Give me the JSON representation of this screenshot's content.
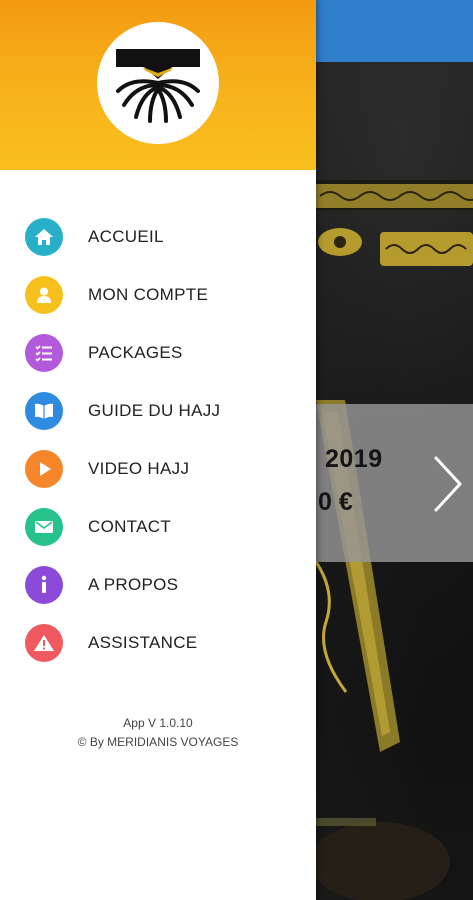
{
  "colors": {
    "header_top": "#f39a12",
    "header_bottom": "#f9bf1e",
    "topbar": "#2f7ecb",
    "icon_home": "#29b0c9",
    "icon_account": "#f7c11d",
    "icon_packages": "#b25adb",
    "icon_guide": "#2f8be0",
    "icon_video": "#f7852a",
    "icon_contact": "#27c28c",
    "icon_about": "#8c4ad8",
    "icon_assistance": "#ef5a61"
  },
  "drawer": {
    "logo": "meridianis-logo",
    "menu": [
      {
        "label": "ACCUEIL",
        "icon": "home-icon"
      },
      {
        "label": "MON COMPTE",
        "icon": "user-icon"
      },
      {
        "label": "PACKAGES",
        "icon": "checklist-icon"
      },
      {
        "label": "GUIDE DU HAJJ",
        "icon": "book-icon"
      },
      {
        "label": "VIDEO HAJJ",
        "icon": "play-icon"
      },
      {
        "label": "CONTACT",
        "icon": "mail-icon"
      },
      {
        "label": "A PROPOS",
        "icon": "info-icon"
      },
      {
        "label": "ASSISTANCE",
        "icon": "warning-icon"
      }
    ],
    "footer": {
      "version": "App V 1.0.10",
      "credit": "© By MERIDIANIS VOYAGES"
    }
  },
  "background": {
    "slide_year": "2019",
    "slide_price": "0 €"
  }
}
